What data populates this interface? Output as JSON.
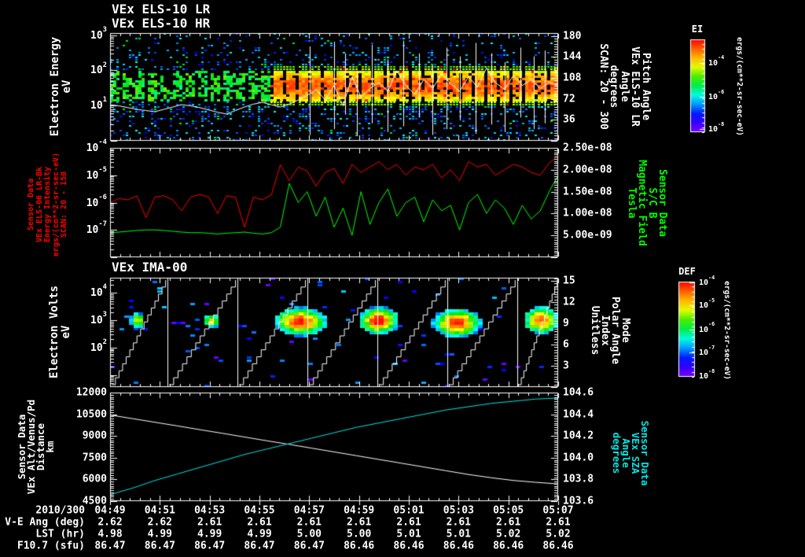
{
  "colors": {
    "background": "#000000",
    "frame": "#ffffff",
    "red": "#ff0000",
    "green": "#00ff00",
    "cyan": "#00e6e6",
    "white": "#ffffff"
  },
  "time_axis": {
    "date": "2010/300",
    "tick_labels": [
      "04:49",
      "04:51",
      "04:53",
      "04:55",
      "04:57",
      "04:59",
      "05:01",
      "05:03",
      "05:05",
      "05:07"
    ]
  },
  "table": {
    "rows": [
      {
        "label": "V-E Ang (deg)",
        "values": [
          "2.62",
          "2.62",
          "2.61",
          "2.61",
          "2.61",
          "2.61",
          "2.61",
          "2.61",
          "2.61",
          "2.61"
        ]
      },
      {
        "label": "LST (hr)",
        "values": [
          "4.98",
          "4.99",
          "4.99",
          "4.99",
          "5.00",
          "5.00",
          "5.01",
          "5.01",
          "5.02",
          "5.02"
        ]
      },
      {
        "label": "F10.7 (sfu)",
        "values": [
          "86.47",
          "86.47",
          "86.47",
          "86.47",
          "86.47",
          "86.46",
          "86.46",
          "86.46",
          "86.46",
          "86.46"
        ]
      }
    ]
  },
  "chart_data": [
    {
      "id": "els10_spectrogram",
      "type": "heatmap",
      "title_lines": [
        "VEx ELS-10 LR",
        "VEx ELS-10 HR"
      ],
      "ylabel_lines": [
        "Electron Energy",
        "eV"
      ],
      "y_axis": {
        "scale": "log",
        "min": 1,
        "max": 1150,
        "tick_labels": [
          "10^3",
          "10^2",
          "10^1"
        ],
        "tick_values": [
          1000,
          100,
          10
        ]
      },
      "right_axis": {
        "min": 0,
        "max": 185,
        "tick_labels": [
          "180",
          "144",
          "108",
          "72",
          "36"
        ],
        "tick_values": [
          180,
          144,
          108,
          72,
          36
        ],
        "label_lines": [
          "Pitch Angle",
          "VEx ELS-10 LR",
          "Angle",
          "degrees",
          "SCAN: 20 - 300"
        ]
      },
      "colorbar": {
        "title": "EI",
        "unit": "ergs/(cm**2-sr-sec-eV)",
        "tick_labels": [
          "10^-4",
          "10^-6",
          "10^-8"
        ],
        "tick_fracs": [
          0.25,
          0.62,
          0.97
        ]
      },
      "pitch_line": {
        "color": "#ffffff",
        "x_step": 0.02,
        "values": [
          62,
          60,
          57,
          54,
          52,
          50,
          54,
          58,
          62,
          60,
          57,
          53,
          49,
          46,
          52,
          58,
          63,
          66,
          62,
          58,
          63,
          70,
          78,
          88,
          70,
          95,
          60,
          110,
          75,
          90,
          100,
          85,
          120,
          95,
          80,
          105,
          90,
          115,
          98,
          85,
          110,
          92,
          125,
          100,
          88,
          112,
          95,
          105,
          90,
          100,
          95
        ]
      },
      "spikes": [
        {
          "x": 0.445,
          "lo": 10,
          "hi": 162
        },
        {
          "x": 0.5,
          "lo": 20,
          "hi": 170
        },
        {
          "x": 0.525,
          "lo": 45,
          "hi": 150
        },
        {
          "x": 0.55,
          "lo": 8,
          "hi": 120
        },
        {
          "x": 0.585,
          "lo": 30,
          "hi": 165
        },
        {
          "x": 0.62,
          "lo": 15,
          "hi": 140
        },
        {
          "x": 0.655,
          "lo": 25,
          "hi": 172
        },
        {
          "x": 0.69,
          "lo": 40,
          "hi": 150
        },
        {
          "x": 0.72,
          "lo": 10,
          "hi": 130
        },
        {
          "x": 0.75,
          "lo": 20,
          "hi": 160
        },
        {
          "x": 0.78,
          "lo": 35,
          "hi": 145
        },
        {
          "x": 0.815,
          "lo": 12,
          "hi": 168
        },
        {
          "x": 0.85,
          "lo": 28,
          "hi": 150
        },
        {
          "x": 0.88,
          "lo": 15,
          "hi": 135
        },
        {
          "x": 0.915,
          "lo": 40,
          "hi": 160
        },
        {
          "x": 0.945,
          "lo": 20,
          "hi": 145
        },
        {
          "x": 0.97,
          "lo": 30,
          "hi": 155
        }
      ],
      "band": {
        "center_log_ev": 1.55,
        "sigma": 0.38,
        "hot_from_frac": 0.36
      },
      "seed": 1337
    },
    {
      "id": "els06_intensity",
      "type": "line",
      "ylabel_lines": [
        "Sensor Data",
        "VEx ELS-06 LR-Bk",
        "Energy Intensity",
        "ergs/(cm**2-sr-sec-eV)",
        "SCAN: 20 - 150"
      ],
      "y_axis": {
        "scale": "log",
        "min": 1e-08,
        "max": 0.0001,
        "tick_labels": [
          "10^-4",
          "10^-5",
          "10^-6",
          "10^-7"
        ],
        "tick_values": [
          -4,
          -5,
          -6,
          -7
        ]
      },
      "right_axis": {
        "min": 0,
        "max": 2.5e-08,
        "tick_labels": [
          "2.50e-08",
          "2.00e-08",
          "1.50e-08",
          "1.00e-08",
          "5.00e-09"
        ],
        "tick_values": [
          2.5e-08,
          2e-08,
          1.5e-08,
          1e-08,
          5e-09
        ],
        "label_lines": [
          "Sensor Data",
          "S/C B",
          "Magnetic Field",
          "Tesla"
        ]
      },
      "series": [
        {
          "name": "energy-intensity",
          "color": "#ff0000",
          "x_step": 0.02,
          "log10_values": [
            -6.0,
            -5.85,
            -5.9,
            -5.75,
            -6.55,
            -5.8,
            -5.75,
            -5.9,
            -6.3,
            -5.8,
            -5.7,
            -5.8,
            -6.4,
            -5.75,
            -5.8,
            -6.9,
            -5.8,
            -5.9,
            -5.72,
            -4.62,
            -5.2,
            -4.7,
            -4.85,
            -5.4,
            -4.9,
            -4.75,
            -5.3,
            -4.6,
            -4.9,
            -4.7,
            -4.5,
            -4.8,
            -4.6,
            -5.0,
            -4.7,
            -4.8,
            -4.6,
            -5.1,
            -4.8,
            -5.2,
            -4.5,
            -4.7,
            -4.6,
            -5.0,
            -4.8,
            -4.6,
            -4.7,
            -4.9,
            -5.0,
            -4.55,
            -4.3
          ]
        },
        {
          "name": "magnetic-field",
          "color": "#00ff00",
          "x_step": 0.02,
          "log10_values": [
            -7.1,
            -7.08,
            -7.05,
            -7.02,
            -7.0,
            -7.0,
            -7.02,
            -7.05,
            -7.08,
            -7.1,
            -7.1,
            -7.12,
            -7.15,
            -7.12,
            -7.1,
            -7.08,
            -7.12,
            -7.15,
            -7.1,
            -6.9,
            -5.3,
            -6.0,
            -5.6,
            -6.5,
            -5.8,
            -6.9,
            -6.2,
            -7.2,
            -5.6,
            -6.8,
            -6.0,
            -5.5,
            -6.5,
            -6.0,
            -5.8,
            -6.7,
            -5.9,
            -6.3,
            -6.1,
            -7.0,
            -6.0,
            -5.7,
            -6.4,
            -5.9,
            -6.2,
            -6.8,
            -6.1,
            -6.6,
            -6.3,
            -5.6,
            -5.0
          ]
        }
      ]
    },
    {
      "id": "ima00_spectrogram",
      "type": "heatmap",
      "title": "VEx IMA-00",
      "ylabel_lines": [
        "Electron Volts",
        "eV"
      ],
      "y_axis": {
        "scale": "log",
        "min": 3.63,
        "max": 36300,
        "tick_labels": [
          "10^4",
          "10^3",
          "10^2"
        ],
        "tick_values": [
          10000,
          1000,
          100
        ]
      },
      "right_axis": {
        "min": 0,
        "max": 15.45,
        "tick_labels": [
          "15",
          "12",
          "9",
          "6",
          "3"
        ],
        "tick_values": [
          15,
          12,
          9,
          6,
          3
        ],
        "label_lines": [
          "Mode",
          "Polar Angle",
          "Index",
          "Unitless"
        ]
      },
      "colorbar": {
        "title": "DEF",
        "unit": "ergs/(cm**2-sr-sec-eV)",
        "tick_labels": [
          "10^-4",
          "10^-5",
          "10^-6",
          "10^-7",
          "10^-8"
        ],
        "tick_fracs": [
          0.01,
          0.25,
          0.5,
          0.745,
          0.99
        ]
      },
      "separators_x": [
        0.128,
        0.284,
        0.44,
        0.596,
        0.752,
        0.908
      ],
      "ramps": [
        [
          0.004,
          0.124
        ],
        [
          0.132,
          0.28
        ],
        [
          0.288,
          0.436
        ],
        [
          0.444,
          0.592
        ],
        [
          0.6,
          0.748
        ],
        [
          0.756,
          0.904
        ],
        [
          0.912,
          0.998
        ]
      ],
      "blobs": [
        {
          "cx": 0.062,
          "log_ev": 3.0,
          "rx": 0.018,
          "ry": 0.28,
          "peak": 0.72
        },
        {
          "cx": 0.228,
          "log_ev": 2.98,
          "rx": 0.02,
          "ry": 0.26,
          "peak": 0.75
        },
        {
          "cx": 0.425,
          "log_ev": 2.95,
          "rx": 0.055,
          "ry": 0.5,
          "peak": 0.97
        },
        {
          "cx": 0.6,
          "log_ev": 2.98,
          "rx": 0.042,
          "ry": 0.48,
          "peak": 1.0
        },
        {
          "cx": 0.775,
          "log_ev": 2.9,
          "rx": 0.052,
          "ry": 0.5,
          "peak": 0.95
        },
        {
          "cx": 0.962,
          "log_ev": 3.0,
          "rx": 0.038,
          "ry": 0.5,
          "peak": 0.9
        }
      ],
      "seed": 777
    },
    {
      "id": "ephemeris",
      "type": "line",
      "ylabel_lines": [
        "Sensor Data",
        "VEx Alt/Venus/Pd",
        "Distance",
        "km"
      ],
      "y_axis": {
        "scale": "linear",
        "min": 4500,
        "max": 12000,
        "tick_labels": [
          "12000",
          "10500",
          "9000",
          "7500",
          "6000",
          "4500"
        ],
        "tick_values": [
          12000,
          10500,
          9000,
          7500,
          6000,
          4500
        ]
      },
      "right_axis": {
        "min": 103.6,
        "max": 104.6,
        "tick_labels": [
          "104.6",
          "104.4",
          "104.2",
          "104.0",
          "103.8",
          "103.6"
        ],
        "tick_values": [
          104.6,
          104.4,
          104.2,
          104.0,
          103.8,
          103.6
        ],
        "label_lines": [
          "Sensor Data",
          "VEx SZA",
          "Angle",
          "degrees"
        ]
      },
      "series": [
        {
          "name": "altitude-km",
          "color": "#ffffff",
          "axis": "left",
          "x_step": 0.05,
          "values": [
            10450,
            10200,
            9950,
            9700,
            9440,
            9190,
            8930,
            8670,
            8420,
            8160,
            7900,
            7640,
            7380,
            7120,
            6860,
            6600,
            6340,
            6120,
            5930,
            5800,
            5690
          ]
        },
        {
          "name": "sza-degrees",
          "color": "#00e6e6",
          "axis": "right",
          "x_step": 0.05,
          "values": [
            103.66,
            103.72,
            103.79,
            103.85,
            103.91,
            103.97,
            104.03,
            104.08,
            104.13,
            104.18,
            104.23,
            104.28,
            104.32,
            104.36,
            104.4,
            104.44,
            104.47,
            104.5,
            104.52,
            104.54,
            104.55
          ]
        }
      ]
    }
  ]
}
